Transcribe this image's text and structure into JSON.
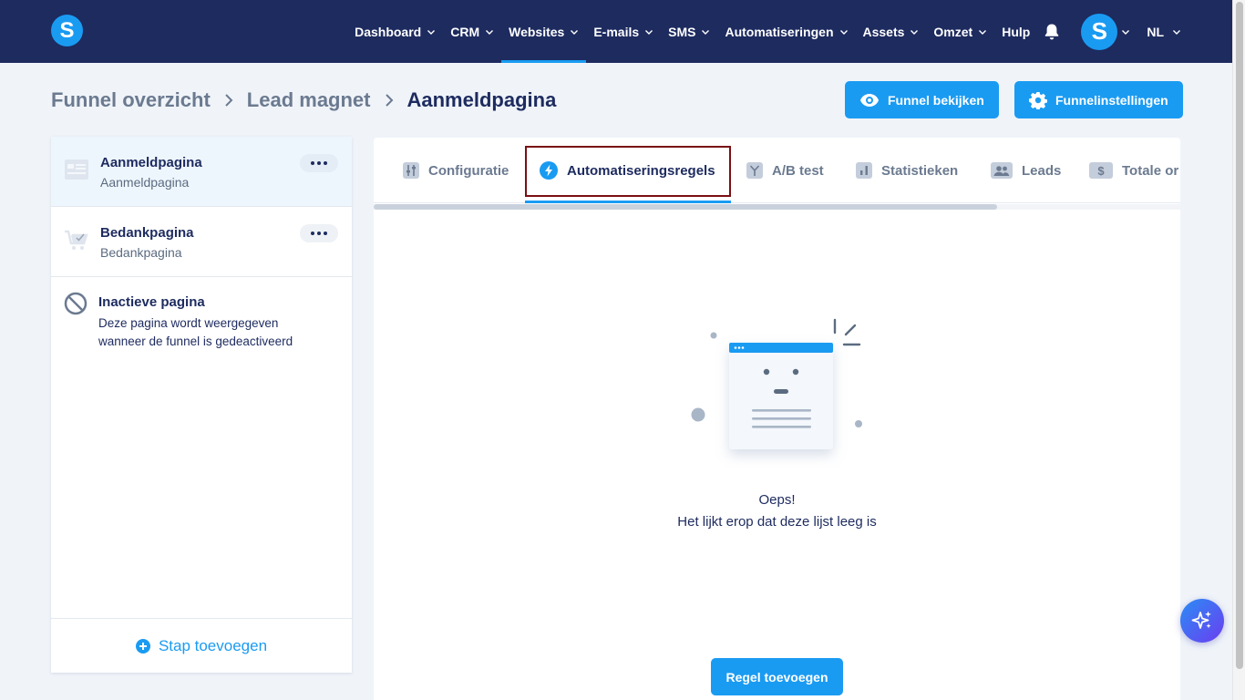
{
  "app": {
    "logo_letter": "S",
    "avatar_letter": "S",
    "language": "NL"
  },
  "nav": {
    "items": [
      {
        "label": "Dashboard",
        "has_dropdown": true,
        "active": false
      },
      {
        "label": "CRM",
        "has_dropdown": true,
        "active": false
      },
      {
        "label": "Websites",
        "has_dropdown": true,
        "active": true
      },
      {
        "label": "E-mails",
        "has_dropdown": true,
        "active": false
      },
      {
        "label": "SMS",
        "has_dropdown": true,
        "active": false
      },
      {
        "label": "Automatiseringen",
        "has_dropdown": true,
        "active": false
      },
      {
        "label": "Assets",
        "has_dropdown": true,
        "active": false
      },
      {
        "label": "Omzet",
        "has_dropdown": true,
        "active": false
      },
      {
        "label": "Hulp",
        "has_dropdown": false,
        "active": false
      }
    ]
  },
  "breadcrumb": {
    "items": [
      "Funnel overzicht",
      "Lead magnet"
    ],
    "current": "Aanmeldpagina"
  },
  "header_buttons": {
    "view_funnel": "Funnel bekijken",
    "funnel_settings": "Funnelinstellingen"
  },
  "sidebar": {
    "pages": [
      {
        "title": "Aanmeldpagina",
        "subtitle": "Aanmeldpagina",
        "selected": true
      },
      {
        "title": "Bedankpagina",
        "subtitle": "Bedankpagina",
        "selected": false
      }
    ],
    "inactive": {
      "title": "Inactieve pagina",
      "description": "Deze pagina wordt weergegeven wanneer de funnel is gedeactiveerd"
    },
    "add_step": "Stap toevoegen"
  },
  "tabs": {
    "configuration": "Configuratie",
    "automation_rules": "Automatiseringsregels",
    "ab_test": "A/B test",
    "statistics": "Statistieken",
    "leads": "Leads",
    "total_revenue": "Totale or",
    "active_tab": "Automatiseringsregels"
  },
  "empty_state": {
    "title": "Oeps!",
    "message": "Het lijkt erop dat deze lijst leeg is",
    "button": "Regel toevoegen"
  },
  "colors": {
    "nav_bg": "#1d2b5f",
    "accent": "#1a9bf2",
    "highlight_border": "#7a0f14",
    "page_bg": "#f0f4f9"
  },
  "icons": {
    "bell": "bell-icon",
    "eye": "eye-icon",
    "gear": "gear-icon",
    "ai": "sparkles-icon"
  }
}
